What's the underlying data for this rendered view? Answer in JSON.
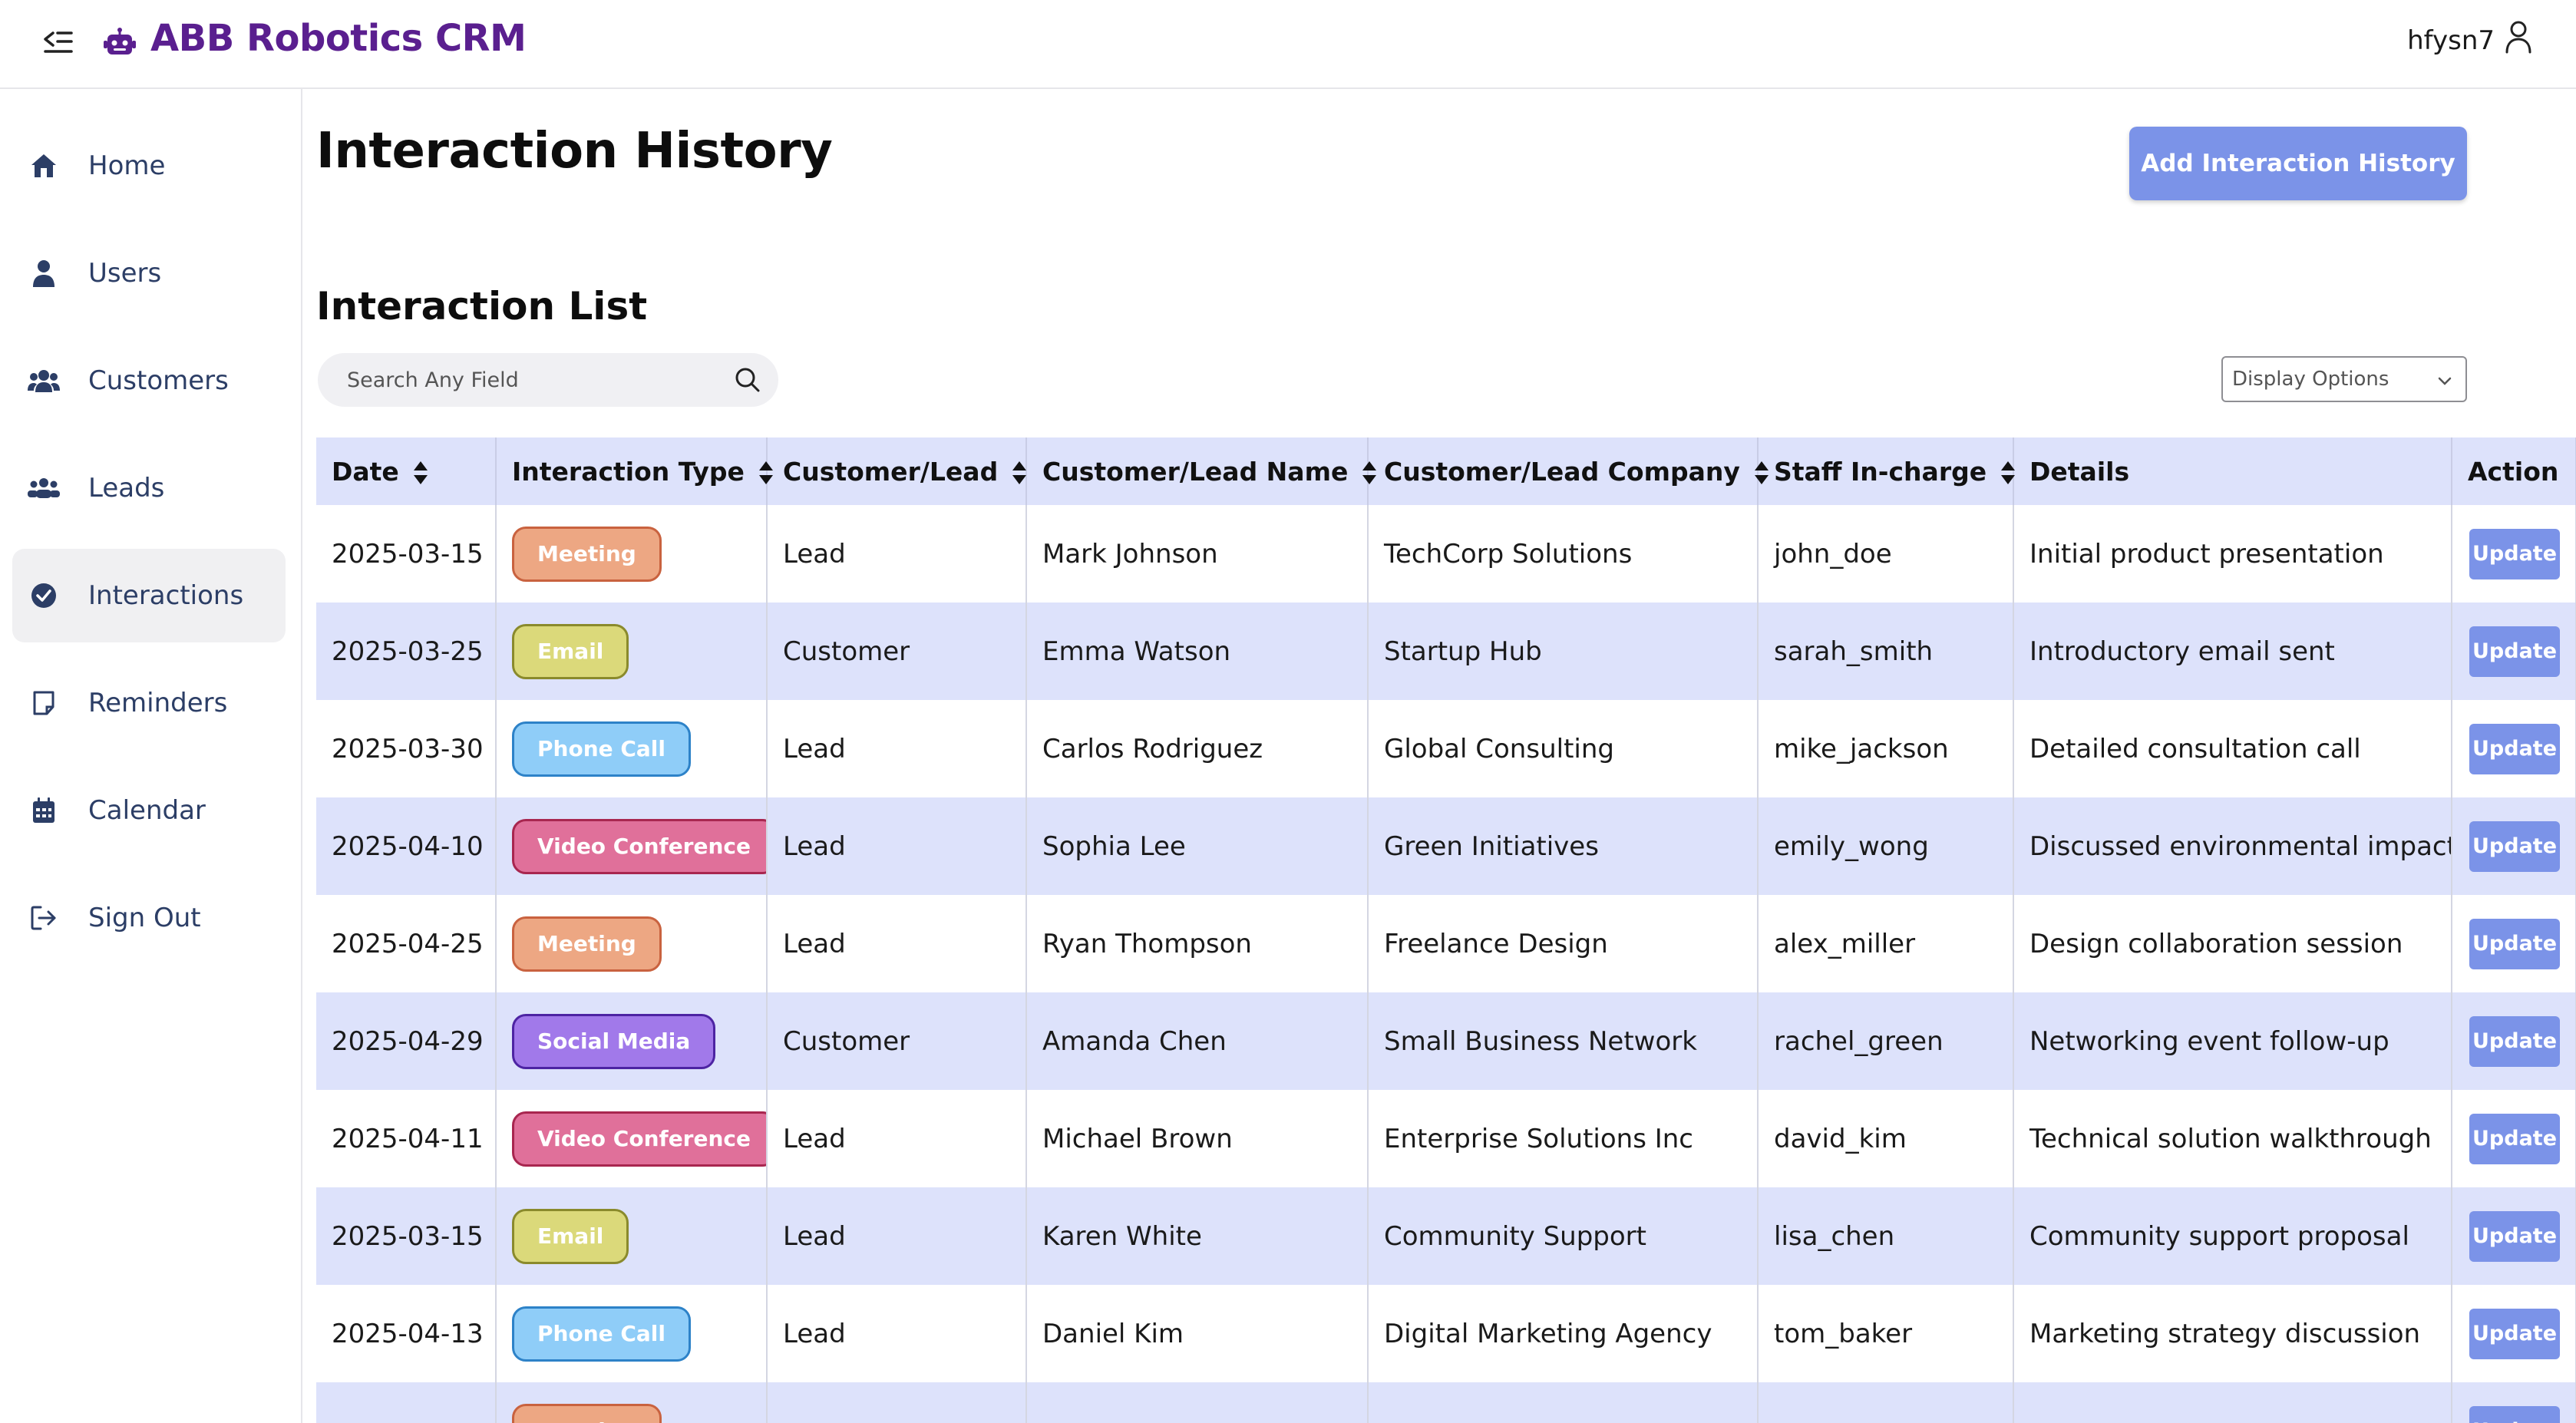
{
  "app": {
    "title": "ABB Robotics CRM",
    "username": "hfysn7"
  },
  "sidebar": {
    "items": [
      {
        "label": "Home",
        "icon": "home-icon",
        "active": false
      },
      {
        "label": "Users",
        "icon": "user-icon",
        "active": false
      },
      {
        "label": "Customers",
        "icon": "customers-icon",
        "active": false
      },
      {
        "label": "Leads",
        "icon": "leads-icon",
        "active": false
      },
      {
        "label": "Interactions",
        "icon": "check-circle-icon",
        "active": true
      },
      {
        "label": "Reminders",
        "icon": "note-icon",
        "active": false
      },
      {
        "label": "Calendar",
        "icon": "calendar-icon",
        "active": false
      },
      {
        "label": "Sign Out",
        "icon": "sign-out-icon",
        "active": false
      }
    ]
  },
  "page": {
    "title": "Interaction History",
    "add_button": "Add Interaction History",
    "section_title": "Interaction List",
    "search_placeholder": "Search Any Field",
    "display_options": "Display Options"
  },
  "table": {
    "headers": [
      "Date",
      "Interaction Type",
      "Customer/Lead",
      "Customer/Lead Name",
      "Customer/Lead Company",
      "Staff In-charge",
      "Details",
      "Action"
    ],
    "action_label": "Update",
    "rows": [
      {
        "date": "2025-03-15",
        "type": "Meeting",
        "kind": "Lead",
        "name": "Mark Johnson",
        "company": "TechCorp Solutions",
        "staff": "john_doe",
        "details": "Initial product presentation"
      },
      {
        "date": "2025-03-25",
        "type": "Email",
        "kind": "Customer",
        "name": "Emma Watson",
        "company": "Startup Hub",
        "staff": "sarah_smith",
        "details": "Introductory email sent"
      },
      {
        "date": "2025-03-30",
        "type": "Phone Call",
        "kind": "Lead",
        "name": "Carlos Rodriguez",
        "company": "Global Consulting",
        "staff": "mike_jackson",
        "details": "Detailed consultation call"
      },
      {
        "date": "2025-04-10",
        "type": "Video Conference",
        "kind": "Lead",
        "name": "Sophia Lee",
        "company": "Green Initiatives",
        "staff": "emily_wong",
        "details": "Discussed environmental impact"
      },
      {
        "date": "2025-04-25",
        "type": "Meeting",
        "kind": "Lead",
        "name": "Ryan Thompson",
        "company": "Freelance Design",
        "staff": "alex_miller",
        "details": "Design collaboration session"
      },
      {
        "date": "2025-04-29",
        "type": "Social Media",
        "kind": "Customer",
        "name": "Amanda Chen",
        "company": "Small Business Network",
        "staff": "rachel_green",
        "details": "Networking event follow-up"
      },
      {
        "date": "2025-04-11",
        "type": "Video Conference",
        "kind": "Lead",
        "name": "Michael Brown",
        "company": "Enterprise Solutions Inc",
        "staff": "david_kim",
        "details": "Technical solution walkthrough"
      },
      {
        "date": "2025-03-15",
        "type": "Email",
        "kind": "Lead",
        "name": "Karen White",
        "company": "Community Support",
        "staff": "lisa_chen",
        "details": "Community support proposal"
      },
      {
        "date": "2025-04-13",
        "type": "Phone Call",
        "kind": "Lead",
        "name": "Daniel Kim",
        "company": "Digital Marketing Agency",
        "staff": "tom_baker",
        "details": "Marketing strategy discussion"
      },
      {
        "date": "",
        "type": "Meeting",
        "kind": "",
        "name": "",
        "company": "",
        "staff": "",
        "details": ""
      }
    ]
  },
  "colors": {
    "brand": "#5a1f8f",
    "accent_button": "#7b93e8",
    "table_header_bg": "#dde2fb",
    "row_alt_bg": "#dde2fb",
    "badge_meeting": "#eda783",
    "badge_email": "#dbd97a",
    "badge_phone": "#8fcdf8",
    "badge_video": "#e0709a",
    "badge_social": "#a179ea"
  }
}
